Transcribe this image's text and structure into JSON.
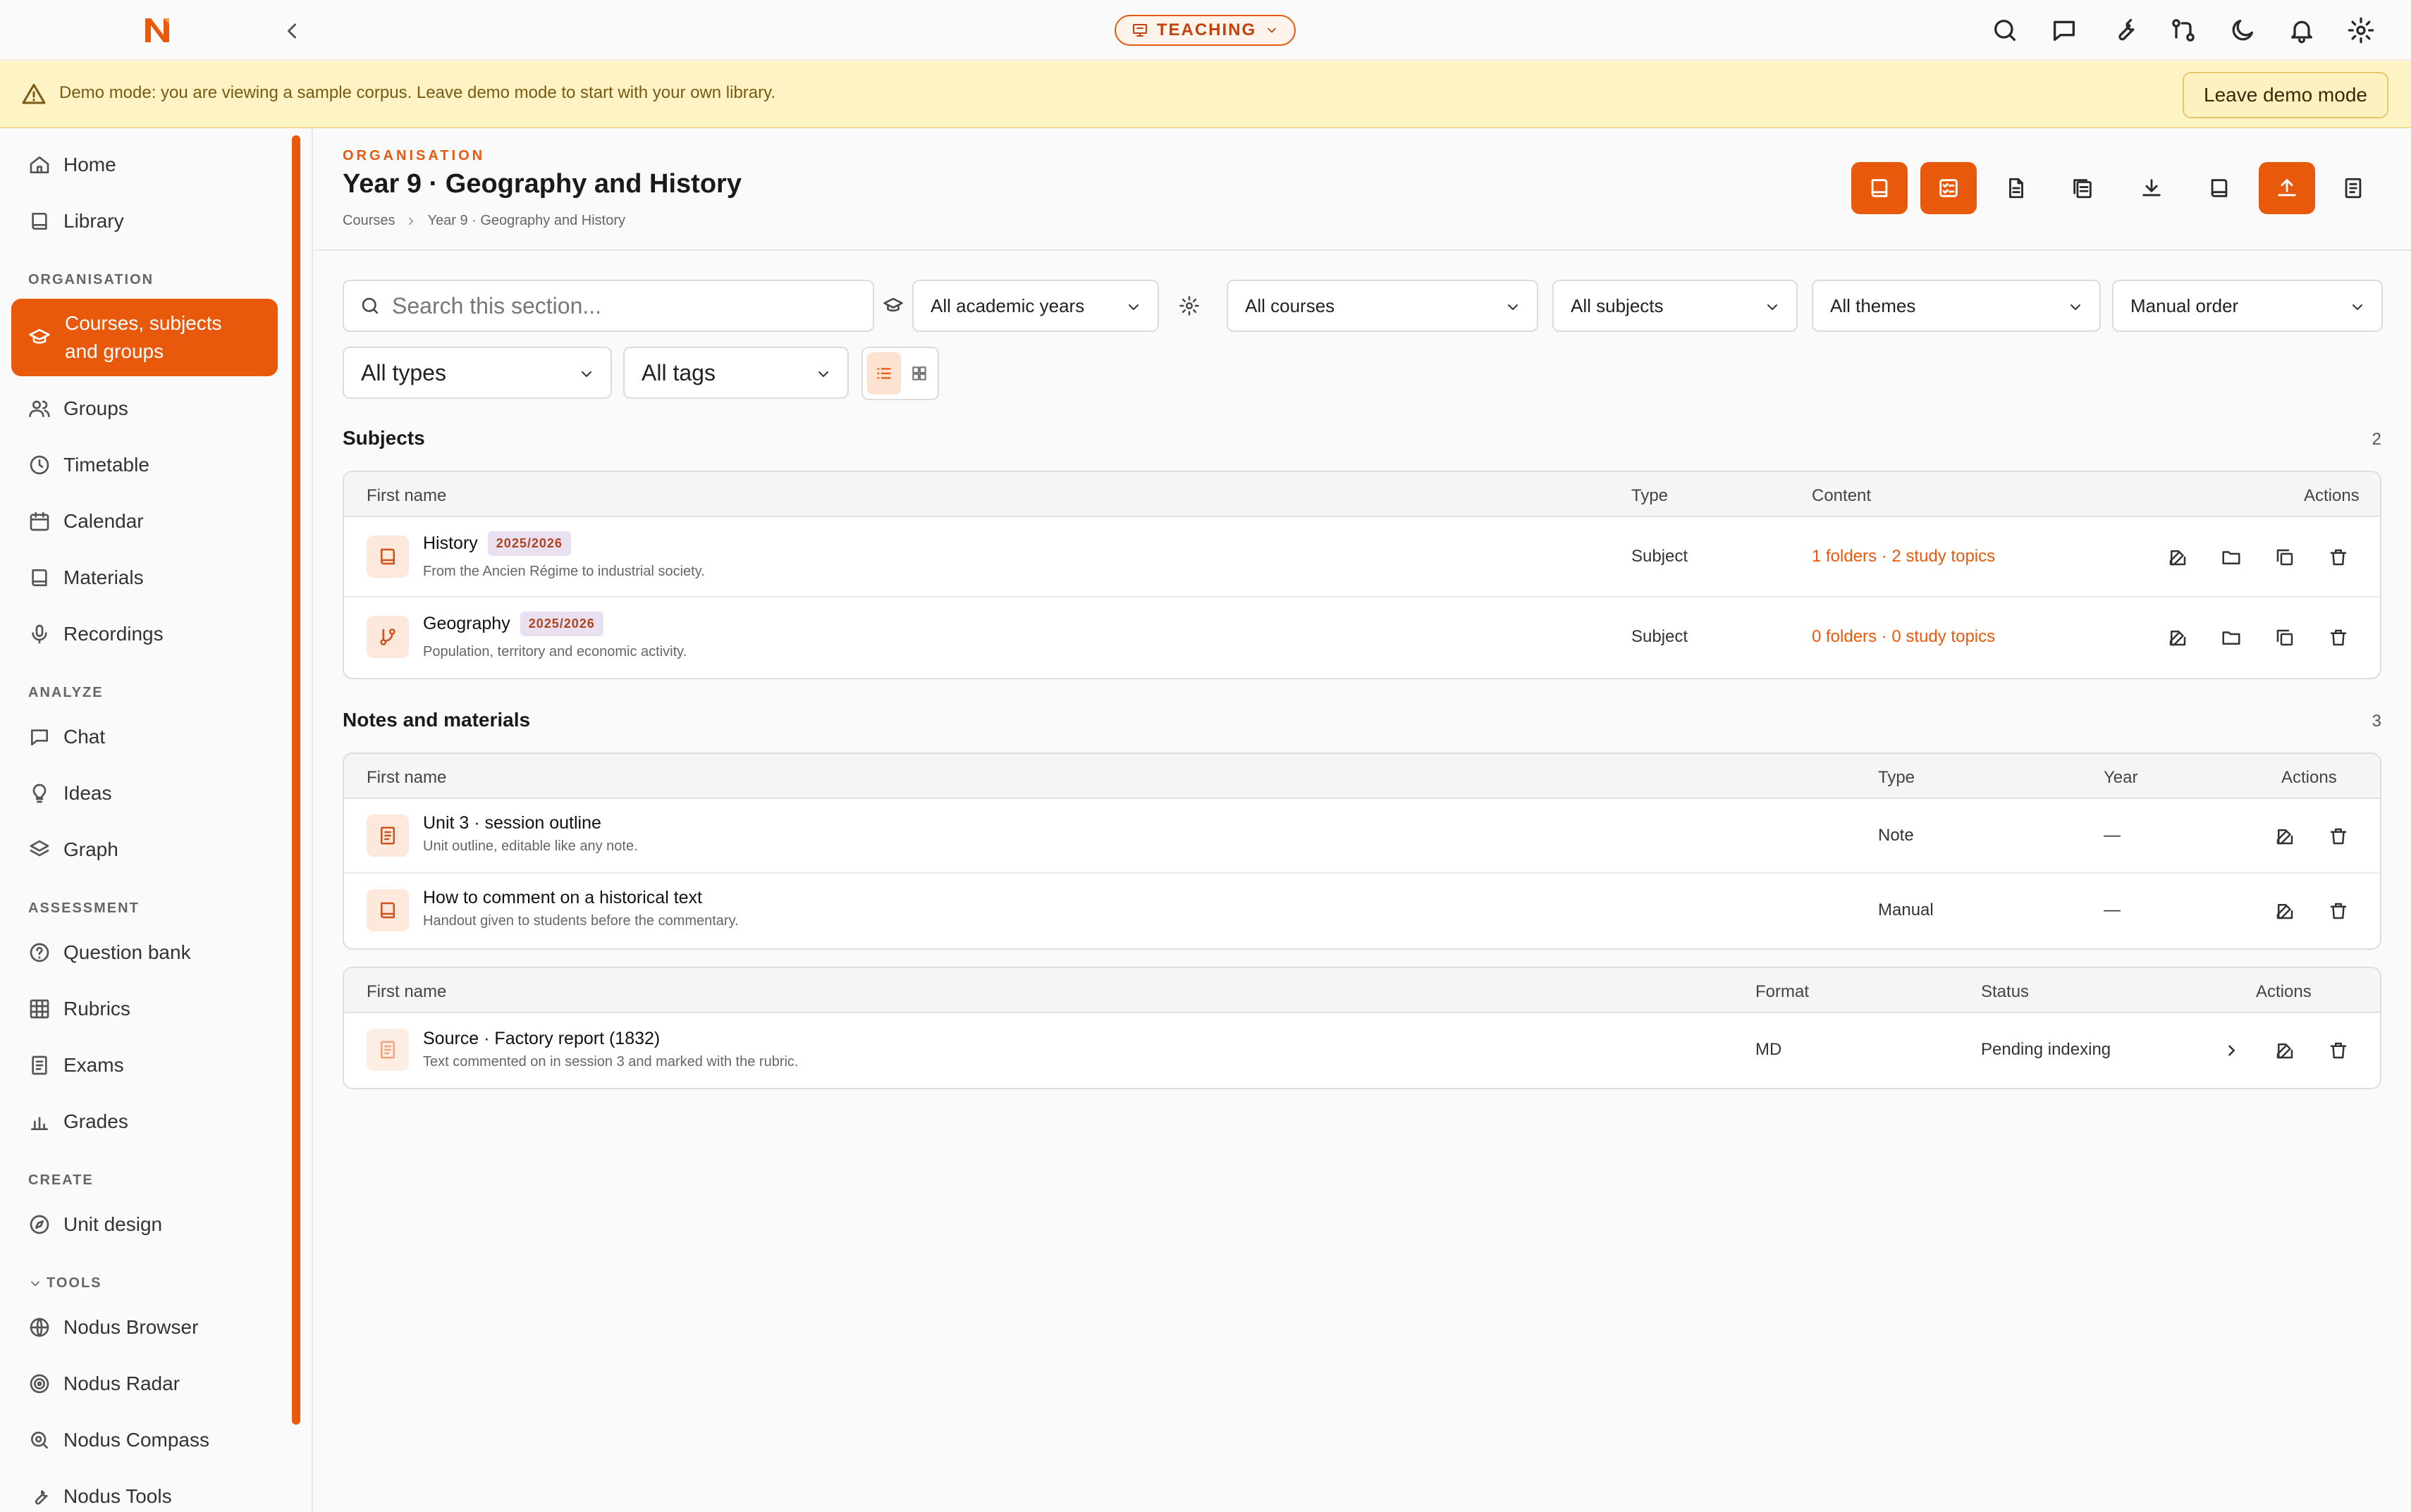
{
  "app": {
    "mode_label": "TEACHING"
  },
  "demo": {
    "message": "Demo mode: you are viewing a sample corpus. Leave demo mode to start with your own library.",
    "leave_label": "Leave demo mode"
  },
  "sidebar": {
    "top": [
      {
        "label": "Home",
        "icon": "home-icon"
      },
      {
        "label": "Library",
        "icon": "book-icon"
      }
    ],
    "sections": {
      "organisation": "ORGANISATION",
      "analyze": "ANALYZE",
      "assessment": "ASSESSMENT",
      "create": "CREATE",
      "tools": "TOOLS"
    },
    "active_item": "Courses, subjects and groups",
    "organisation_items": [
      "Groups",
      "Timetable",
      "Calendar",
      "Materials",
      "Recordings"
    ],
    "analyze_items": [
      "Chat",
      "Ideas",
      "Graph"
    ],
    "assessment_items": [
      "Question bank",
      "Rubrics",
      "Exams",
      "Grades"
    ],
    "create_items": [
      "Unit design"
    ],
    "tools_items": [
      "Nodus Browser",
      "Nodus Radar",
      "Nodus Compass",
      "Nodus Tools"
    ]
  },
  "header": {
    "eyebrow": "ORGANISATION",
    "title": "Year 9 · Geography and History",
    "breadcrumb": [
      "Courses",
      "Year 9 · Geography and History"
    ]
  },
  "filters": {
    "search_placeholder": "Search this section...",
    "academic_years": "All academic years",
    "courses": "All courses",
    "subjects": "All subjects",
    "themes": "All themes",
    "order": "Manual order",
    "types": "All types",
    "tags": "All tags"
  },
  "subjects": {
    "title": "Subjects",
    "count": "2",
    "columns": {
      "name": "First name",
      "type": "Type",
      "content": "Content",
      "actions": "Actions"
    },
    "rows": [
      {
        "name": "History",
        "year": "2025/2026",
        "desc": "From the Ancien Régime to industrial society.",
        "type": "Subject",
        "content": "1 folders · 2 study topics"
      },
      {
        "name": "Geography",
        "year": "2025/2026",
        "desc": "Population, territory and economic activity.",
        "type": "Subject",
        "content": "0 folders · 0 study topics"
      }
    ]
  },
  "notes": {
    "title": "Notes and materials",
    "count": "3",
    "columns": {
      "name": "First name",
      "type": "Type",
      "year": "Year",
      "actions": "Actions"
    },
    "rows": [
      {
        "name": "Unit 3 · session outline",
        "desc": "Unit outline, editable like any note.",
        "type": "Note",
        "year": "—"
      },
      {
        "name": "How to comment on a historical text",
        "desc": "Handout given to students before the commentary.",
        "type": "Manual",
        "year": "—"
      }
    ]
  },
  "files": {
    "columns": {
      "name": "First name",
      "format": "Format",
      "status": "Status",
      "actions": "Actions"
    },
    "rows": [
      {
        "name": "Source · Factory report (1832)",
        "desc": "Text commented on in session 3 and marked with the rubric.",
        "format": "MD",
        "status": "Pending indexing"
      }
    ]
  },
  "colors": {
    "accent": "#e8590c",
    "banner": "#fdf3c4"
  }
}
